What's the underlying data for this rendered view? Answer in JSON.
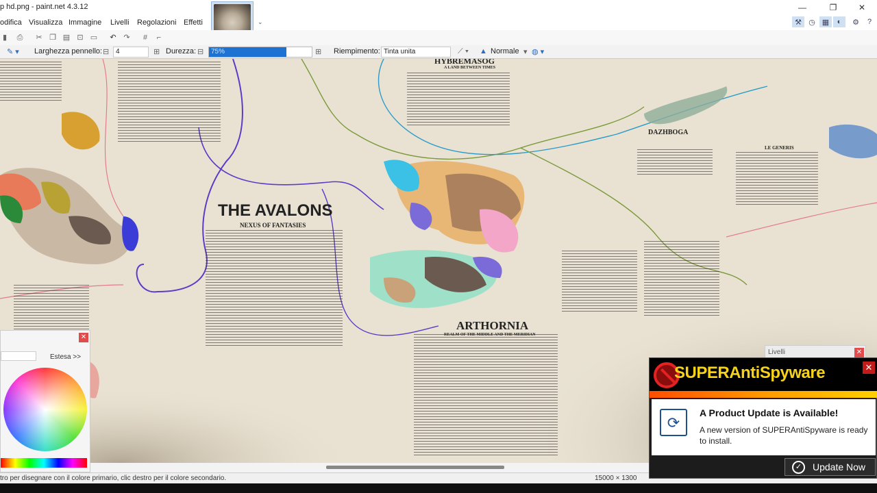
{
  "window": {
    "title": "p hd.png - paint.net 4.3.12",
    "minimize_glyph": "—",
    "restore_glyph": "❐",
    "close_glyph": "✕"
  },
  "menu": {
    "items": [
      "odifica",
      "Visualizza",
      "Immagine",
      "Livelli",
      "Regolazioni",
      "Effetti"
    ]
  },
  "toolbar": {
    "brush_width_label": "Larghezza pennello:",
    "brush_width_value": "4",
    "hardness_label": "Durezza:",
    "hardness_value": "75%",
    "hardness_percent": 75,
    "fill_label": "Riempimento:",
    "fill_value": "Tinta unita",
    "blend_value": "Normale"
  },
  "map": {
    "hybremasog": "HYBREMASOG",
    "hybremasog_sub": "A LAND BETWEEN TIMES",
    "avalons": "THE AVALONS",
    "avalons_sub": "NEXUS OF FANTASIES",
    "arthornia": "ARTHORNIA",
    "arthornia_sub": "REALM OF THE MIDDLE AND THE MERIDIAN",
    "dazhboga": "DAZHBOGA",
    "le_generis": "LE GENERIS"
  },
  "palette": {
    "extend_label": "Estesa >>"
  },
  "layers_panel": {
    "title": "Livelli"
  },
  "status": {
    "hint": "tro per disegnare con il colore primario, clic destro per il colore secondario.",
    "image_size": "15000 × 1300"
  },
  "popup": {
    "brand": "SUPERAntiSpyware",
    "title": "A Product Update is Available!",
    "message": "A new version of SUPERAntiSpyware is ready to install.",
    "button": "Update Now",
    "close_glyph": "✕"
  }
}
